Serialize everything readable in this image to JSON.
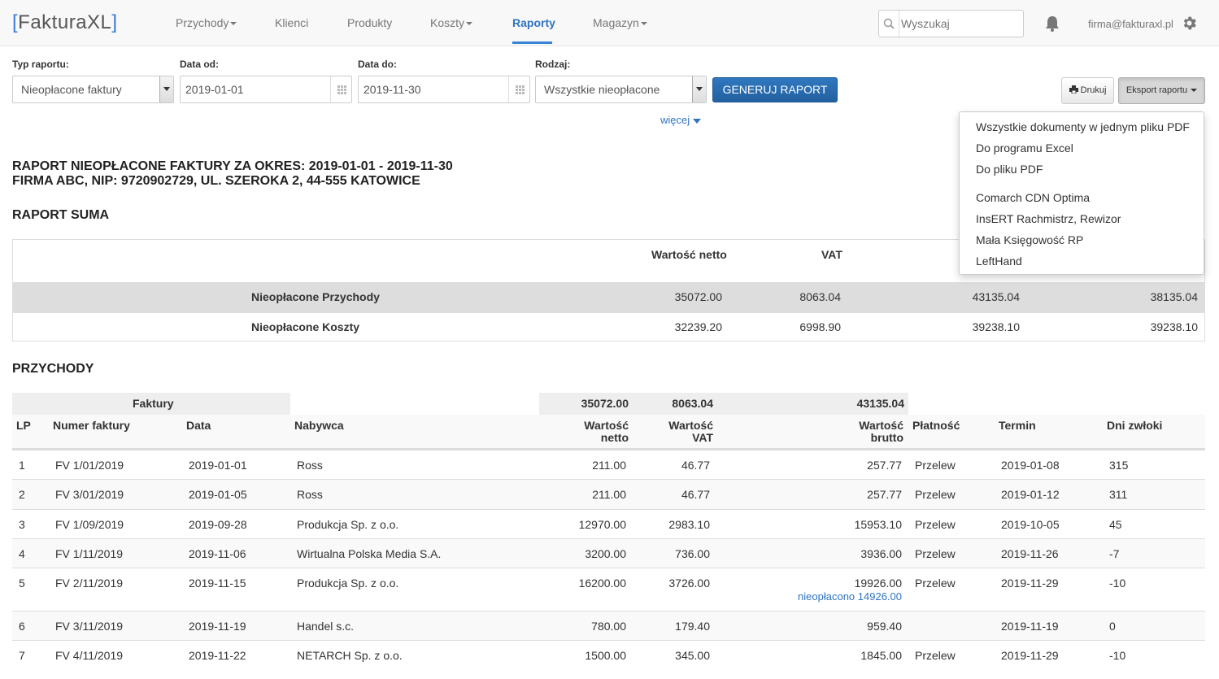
{
  "brand": {
    "open": "[",
    "name": "FakturaXL",
    "close": "]"
  },
  "nav": {
    "przychody": "Przychody",
    "klienci": "Klienci",
    "produkty": "Produkty",
    "koszty": "Koszty",
    "raporty": "Raporty",
    "magazyn": "Magazyn"
  },
  "search": {
    "placeholder": "Wyszukaj"
  },
  "user": {
    "email": "firma@fakturaxl.pl"
  },
  "form": {
    "type_label": "Typ raportu:",
    "type_value": "Nieopłacone faktury",
    "from_label": "Data od:",
    "from_value": "2019-01-01",
    "to_label": "Data do:",
    "to_value": "2019-11-30",
    "kind_label": "Rodzaj:",
    "kind_value": "Wszystkie nieopłacone",
    "generate": "GENERUJ RAPORT",
    "more": "więcej",
    "print": "Drukuj",
    "export": "Eksport raportu"
  },
  "export_menu": {
    "all_pdf": "Wszystkie dokumenty w jednym pliku PDF",
    "excel": "Do programu Excel",
    "pdf": "Do pliku PDF",
    "cdn": "Comarch CDN Optima",
    "insert": "InsERT Rachmistrz, Rewizor",
    "mala": "Mała Księgowość RP",
    "lefthand": "LeftHand"
  },
  "report": {
    "title1": "RAPORT NIEOPŁACONE FAKTURY ZA OKRES: 2019-01-01 - 2019-11-30",
    "title2": "FIRMA ABC, NIP: 9720902729, UL. SZEROKA 2, 44-555 KATOWICE",
    "sum_title": "RAPORT SUMA",
    "sum_headers": {
      "netto": "Wartość netto",
      "vat": "VAT"
    },
    "sum_rows": [
      {
        "name": "Nieopłacone Przychody",
        "netto": "35072.00",
        "vat": "8063.04",
        "brutto": "43135.04",
        "col4": "38135.04"
      },
      {
        "name": "Nieopłacone Koszty",
        "netto": "32239.20",
        "vat": "6998.90",
        "brutto": "39238.10",
        "col4": "39238.10"
      }
    ],
    "income_title": "PRZYCHODY",
    "totals": {
      "label": "Faktury",
      "netto": "35072.00",
      "vat": "8063.04",
      "brutto": "43135.04"
    },
    "headers": {
      "lp": "LP",
      "number": "Numer faktury",
      "date": "Data",
      "buyer": "Nabywca",
      "netto1": "Wartość",
      "netto2": "netto",
      "vat1": "Wartość",
      "vat2": "VAT",
      "brutto1": "Wartość",
      "brutto2": "brutto",
      "payment": "Płatność",
      "due": "Termin",
      "delay": "Dni zwłoki"
    },
    "rows": [
      {
        "lp": "1",
        "number": "FV 1/01/2019",
        "date": "2019-01-01",
        "buyer": "Ross",
        "netto": "211.00",
        "vat": "46.77",
        "brutto": "257.77",
        "payment": "Przelew",
        "due": "2019-01-08",
        "delay": "315"
      },
      {
        "lp": "2",
        "number": "FV 3/01/2019",
        "date": "2019-01-05",
        "buyer": "Ross",
        "netto": "211.00",
        "vat": "46.77",
        "brutto": "257.77",
        "payment": "Przelew",
        "due": "2019-01-12",
        "delay": "311"
      },
      {
        "lp": "3",
        "number": "FV 1/09/2019",
        "date": "2019-09-28",
        "buyer": "Produkcja Sp. z o.o.",
        "netto": "12970.00",
        "vat": "2983.10",
        "brutto": "15953.10",
        "payment": "Przelew",
        "due": "2019-10-05",
        "delay": "45"
      },
      {
        "lp": "4",
        "number": "FV 1/11/2019",
        "date": "2019-11-06",
        "buyer": "Wirtualna Polska Media S.A.",
        "netto": "3200.00",
        "vat": "736.00",
        "brutto": "3936.00",
        "payment": "Przelew",
        "due": "2019-11-26",
        "delay": "-7"
      },
      {
        "lp": "5",
        "number": "FV 2/11/2019",
        "date": "2019-11-15",
        "buyer": "Produkcja Sp. z o.o.",
        "netto": "16200.00",
        "vat": "3726.00",
        "brutto": "19926.00",
        "note": "nieopłacono 14926.00",
        "payment": "Przelew",
        "due": "2019-11-29",
        "delay": "-10"
      },
      {
        "lp": "6",
        "number": "FV 3/11/2019",
        "date": "2019-11-19",
        "buyer": "Handel s.c.",
        "netto": "780.00",
        "vat": "179.40",
        "brutto": "959.40",
        "payment": "",
        "due": "2019-11-19",
        "delay": "0"
      },
      {
        "lp": "7",
        "number": "FV 4/11/2019",
        "date": "2019-11-22",
        "buyer": "NETARCH Sp. z o.o.",
        "netto": "1500.00",
        "vat": "345.00",
        "brutto": "1845.00",
        "payment": "Przelew",
        "due": "2019-11-29",
        "delay": "-10"
      }
    ]
  }
}
